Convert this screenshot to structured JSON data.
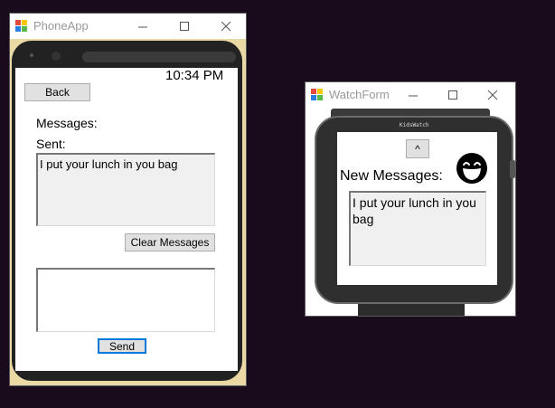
{
  "phone": {
    "title": "PhoneApp",
    "time": "10:34 PM",
    "back_label": "Back",
    "messages_label": "Messages:",
    "sent_label": "Sent:",
    "received_text": "I put your lunch in you bag",
    "clear_label": "Clear Messages",
    "compose_text": "",
    "send_label": "Send"
  },
  "watch": {
    "title": "WatchForm",
    "brand": "KidsWatch",
    "up_label": "^",
    "new_messages_label": "New Messages:",
    "message_text": "I put your lunch in you bag",
    "avatar_icon": "laughing-face-icon"
  },
  "colors": {
    "desktop": "#1a0b1c",
    "focus": "#0078d7",
    "phone_bezel": "#ead9a5",
    "watch_body": "#2f2f2f"
  }
}
